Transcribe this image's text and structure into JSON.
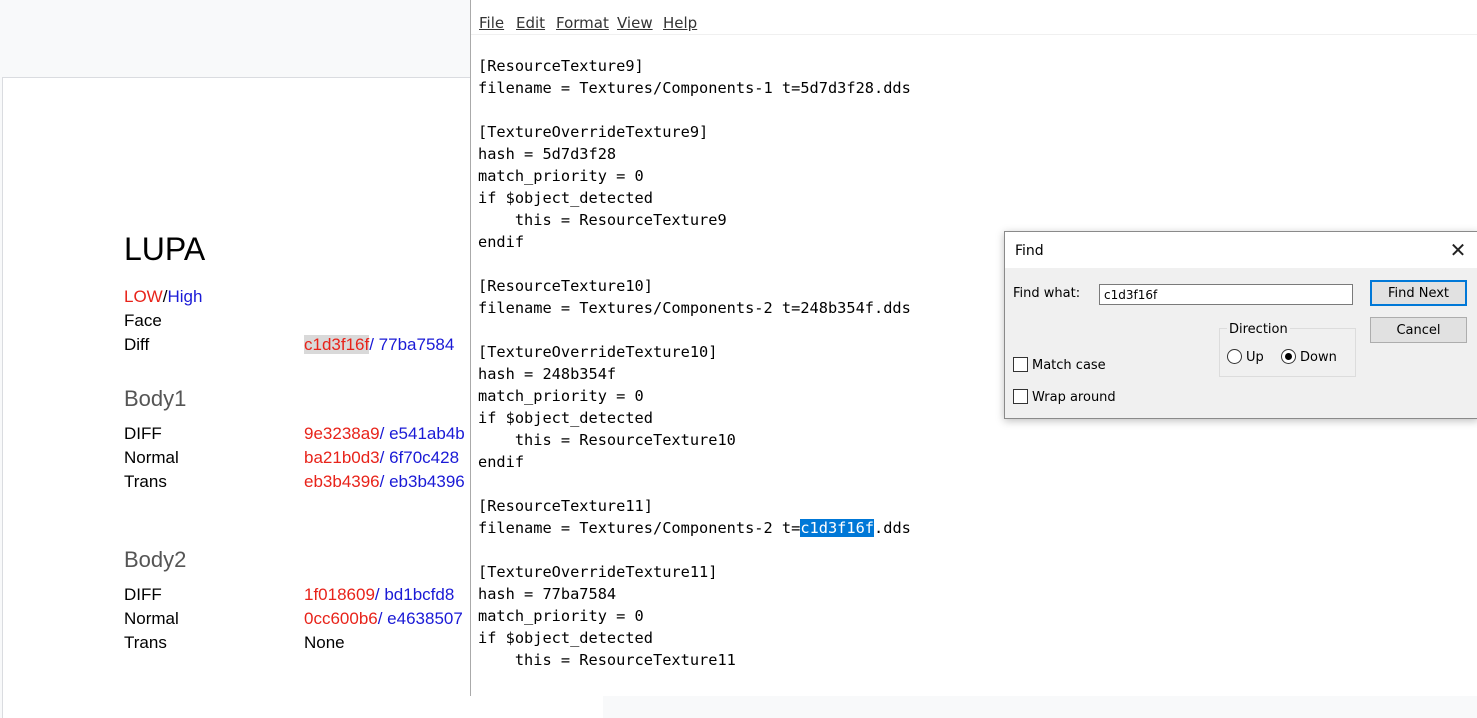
{
  "document": {
    "title": "LUPA",
    "legend_low": "LOW",
    "legend_sep": "/",
    "legend_high": "High",
    "face_label": "Face",
    "diff_label": "Diff",
    "diff_low": "c1d3f16f",
    "diff_high": "/ 77ba7584",
    "body1": {
      "heading": "Body1",
      "rows": [
        {
          "label": "DIFF",
          "low": "9e3238a9",
          "high": "/ e541ab4b"
        },
        {
          "label": "Normal",
          "low": "ba21b0d3",
          "high": "/ 6f70c428"
        },
        {
          "label": "Trans",
          "low": "eb3b4396",
          "high": "/ eb3b4396"
        }
      ]
    },
    "body2": {
      "heading": "Body2",
      "rows": [
        {
          "label": "DIFF",
          "low": "1f018609",
          "high": "/ bd1bcfd8"
        },
        {
          "label": "Normal",
          "low": "0cc600b6",
          "high": "/ e4638507"
        },
        {
          "label": "Trans",
          "value": "None"
        }
      ]
    }
  },
  "notepad": {
    "menu": [
      "File",
      "Edit",
      "Format",
      "View",
      "Help"
    ],
    "lines": [
      "[ResourceTexture9]",
      "filename = Textures/Components-1 t=5d7d3f28.dds",
      "",
      "[TextureOverrideTexture9]",
      "hash = 5d7d3f28",
      "match_priority = 0",
      "if $object_detected",
      "    this = ResourceTexture9",
      "endif",
      "",
      "[ResourceTexture10]",
      "filename = Textures/Components-2 t=248b354f.dds",
      "",
      "[TextureOverrideTexture10]",
      "hash = 248b354f",
      "match_priority = 0",
      "if $object_detected",
      "    this = ResourceTexture10",
      "endif",
      "",
      "[ResourceTexture11]",
      "filename = Textures/Components-2 t=",
      "",
      "[TextureOverrideTexture11]",
      "hash = 77ba7584",
      "match_priority = 0",
      "if $object_detected",
      "    this = ResourceTexture11"
    ],
    "selected_text": "c1d3f16f",
    "after_selection": ".dds"
  },
  "find_dialog": {
    "title": "Find",
    "find_what_label": "Find what:",
    "find_what_value": "c1d3f16f",
    "find_next": "Find Next",
    "cancel": "Cancel",
    "direction_label": "Direction",
    "up": "Up",
    "down": "Down",
    "direction_selected": "Down",
    "match_case": "Match case",
    "match_case_checked": false,
    "wrap_around": "Wrap around",
    "wrap_around_checked": false
  }
}
